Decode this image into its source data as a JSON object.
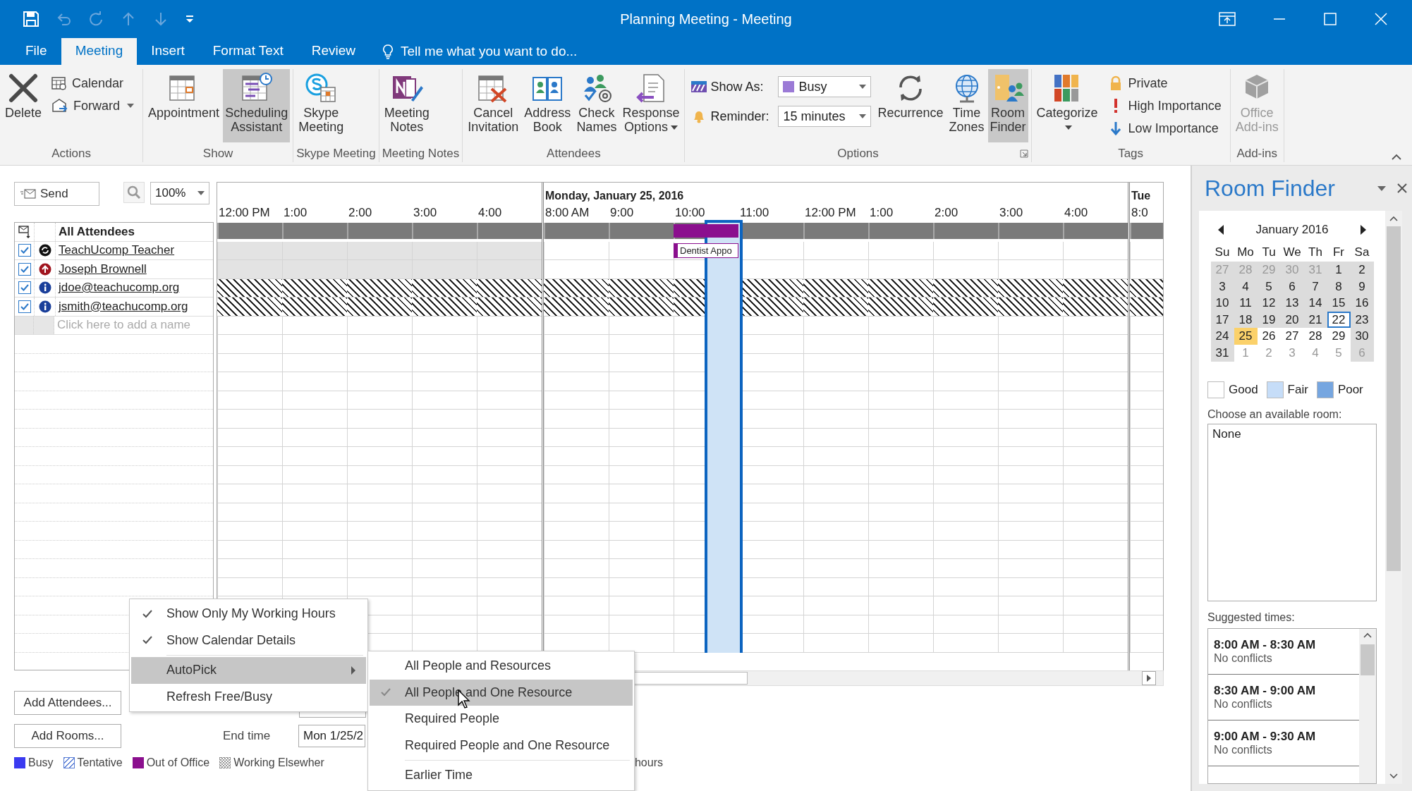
{
  "window": {
    "title": "Planning Meeting - Meeting"
  },
  "quick_access": [
    {
      "kind": "save",
      "disabled": false
    },
    {
      "kind": "undo",
      "disabled": true
    },
    {
      "kind": "redo",
      "disabled": true
    },
    {
      "kind": "previous",
      "disabled": true
    },
    {
      "kind": "next",
      "disabled": true
    },
    {
      "kind": "customize",
      "disabled": false
    }
  ],
  "window_controls": [
    {
      "kind": "ribbon_options"
    },
    {
      "kind": "minimize"
    },
    {
      "kind": "maximize"
    },
    {
      "kind": "close"
    }
  ],
  "tabs": [
    {
      "label": "File",
      "selected": false
    },
    {
      "label": "Meeting",
      "selected": true
    },
    {
      "label": "Insert",
      "selected": false
    },
    {
      "label": "Format Text",
      "selected": false
    },
    {
      "label": "Review",
      "selected": false
    }
  ],
  "tell_me": {
    "placeholder": "Tell me what you want to do..."
  },
  "ribbon_groups": [
    {
      "label": "Actions",
      "buttons": [
        {
          "kind": "delete",
          "label": "Delete"
        }
      ],
      "small_buttons": [
        {
          "kind": "calendar",
          "label": "Calendar"
        },
        {
          "kind": "forward",
          "label": "Forward",
          "dropdown": true
        }
      ]
    },
    {
      "label": "Show",
      "buttons": [
        {
          "kind": "appointment",
          "label": "Appointment",
          "on": false
        },
        {
          "kind": "scheduling_assistant",
          "label": "Scheduling Assistant",
          "on": true
        }
      ]
    },
    {
      "label": "Skype Meeting",
      "buttons": [
        {
          "kind": "skype_meeting",
          "label": "Skype Meeting"
        }
      ]
    },
    {
      "label": "Meeting Notes",
      "buttons": [
        {
          "kind": "meeting_notes",
          "label": "Meeting Notes"
        }
      ]
    },
    {
      "label": "Attendees",
      "buttons": [
        {
          "kind": "cancel_invitation",
          "label": "Cancel Invitation"
        },
        {
          "kind": "address_book",
          "label": "Address Book"
        },
        {
          "kind": "check_names",
          "label": "Check Names"
        },
        {
          "kind": "response_options",
          "label": "Response Options",
          "dropdown": true
        }
      ]
    },
    {
      "label": "Options",
      "launcher": true,
      "fields": [
        {
          "kind": "show_as",
          "label": "Show As:",
          "value": "Busy"
        },
        {
          "kind": "reminder",
          "label": "Reminder:",
          "value": "15 minutes"
        }
      ],
      "buttons": [
        {
          "kind": "recurrence",
          "label": "Recurrence"
        },
        {
          "kind": "time_zones",
          "label": "Time Zones"
        },
        {
          "kind": "room_finder",
          "label": "Room Finder",
          "on": true
        }
      ]
    },
    {
      "label": "Tags",
      "buttons": [
        {
          "kind": "categorize",
          "label": "Categorize",
          "dropdown": true
        }
      ],
      "small_buttons": [
        {
          "kind": "private",
          "label": "Private"
        },
        {
          "kind": "high_importance",
          "label": "High Importance"
        },
        {
          "kind": "low_importance",
          "label": "Low Importance"
        }
      ]
    },
    {
      "label": "Add-ins",
      "buttons": [
        {
          "kind": "office_addins",
          "label": "Office Add-ins",
          "disabled": true
        }
      ]
    }
  ],
  "scheduling": {
    "send_button": "Send",
    "zoom_value": "100%",
    "attendee_header": "All Attendees",
    "attendees": [
      {
        "name": "TeachUcomp Teacher",
        "kind": "organizer",
        "checked": true,
        "days": [
          {
            "kind": "nonworking"
          },
          {
            "kind": "free",
            "slots": [
              {
                "kind": "open"
              },
              {
                "kind": "open"
              },
              {
                "kind": "out_of_office",
                "label": "Dentist Appo"
              },
              {
                "kind": "open"
              },
              {
                "kind": "open"
              },
              {
                "kind": "open"
              },
              {
                "kind": "open"
              },
              {
                "kind": "open"
              },
              {
                "kind": "open"
              }
            ]
          },
          {
            "kind": "free"
          }
        ]
      },
      {
        "name": "Joseph Brownell",
        "kind": "required",
        "checked": true,
        "days": [
          {
            "kind": "nonworking"
          },
          {
            "kind": "free"
          },
          {
            "kind": "free"
          }
        ]
      },
      {
        "name": "jdoe@teachucomp.org",
        "kind": "unknown",
        "checked": true,
        "days": [
          {
            "kind": "no_info"
          },
          {
            "kind": "no_info"
          },
          {
            "kind": "no_info"
          }
        ]
      },
      {
        "name": "jsmith@teachucomp.org",
        "kind": "unknown",
        "checked": true,
        "days": [
          {
            "kind": "no_info"
          },
          {
            "kind": "no_info"
          },
          {
            "kind": "no_info"
          }
        ]
      }
    ],
    "add_name": {
      "placeholder": "Click here to add a name"
    },
    "summary_days": [
      {
        "kind": "summary"
      },
      {
        "kind": "summary",
        "slots": [
          {
            "kind": "open"
          },
          {
            "kind": "open"
          },
          {
            "kind": "out_of_office"
          },
          {
            "kind": "open"
          },
          {
            "kind": "open"
          },
          {
            "kind": "open"
          },
          {
            "kind": "open"
          },
          {
            "kind": "open"
          },
          {
            "kind": "open"
          }
        ]
      },
      {
        "kind": "summary"
      }
    ],
    "days": [
      {
        "hours": [
          {
            "label": "12:00 PM"
          },
          {
            "label": "1:00"
          },
          {
            "label": "2:00"
          },
          {
            "label": "3:00"
          },
          {
            "label": "4:00"
          }
        ]
      },
      {
        "header": "Monday, January 25, 2016",
        "hours": [
          {
            "label": "8:00 AM"
          },
          {
            "label": "9:00"
          },
          {
            "label": "10:00",
            "selection": {
              "kind": "second_half"
            }
          },
          {
            "label": "11:00"
          },
          {
            "label": "12:00 PM"
          },
          {
            "label": "1:00"
          },
          {
            "label": "2:00"
          },
          {
            "label": "3:00"
          },
          {
            "label": "4:00"
          }
        ]
      },
      {
        "header": "Tue",
        "hours": [
          {
            "label": "8:0"
          }
        ]
      }
    ],
    "add_attendees": "Add Attendees...",
    "add_rooms": "Add Rooms...",
    "end_time": {
      "label": "End time",
      "value": "Mon 1/25/2"
    },
    "legend": [
      {
        "kind": "busy",
        "label": "Busy"
      },
      {
        "kind": "tentative",
        "label": "Tentative"
      },
      {
        "kind": "out_of_office",
        "label": "Out of Office"
      },
      {
        "kind": "working_elsewhere",
        "label": "Working Elsewher"
      },
      {
        "kind": "outside_hours",
        "label": "hours"
      }
    ]
  },
  "context_menu": {
    "items": [
      {
        "label": "Show Only My Working Hours",
        "checked": true,
        "selected": false
      },
      {
        "label": "Show Calendar Details",
        "checked": true,
        "selected": false
      },
      {
        "label": "AutoPick",
        "checked": false,
        "selected": true,
        "submenu": true,
        "separator_before": true
      },
      {
        "label": "Refresh Free/Busy",
        "checked": false,
        "selected": false
      }
    ]
  },
  "submenu": {
    "items": [
      {
        "label": "All People and Resources",
        "checked": false,
        "selected": false
      },
      {
        "label": "All People and One Resource",
        "checked": true,
        "selected": true
      },
      {
        "label": "Required People",
        "checked": false,
        "selected": false
      },
      {
        "label": "Required People and One Resource",
        "checked": false,
        "selected": false
      },
      {
        "label": "Earlier Time",
        "checked": false,
        "selected": false,
        "separator_before": true
      }
    ]
  },
  "room_finder": {
    "title": "Room Finder",
    "month": "January 2016",
    "weekdays": [
      "Su",
      "Mo",
      "Tu",
      "We",
      "Th",
      "Fr",
      "Sa"
    ],
    "weeks": [
      [
        {
          "day": "27",
          "other_month": true,
          "shaded": true,
          "today": false,
          "selected": false
        },
        {
          "day": "28",
          "other_month": true,
          "shaded": true,
          "today": false,
          "selected": false
        },
        {
          "day": "29",
          "other_month": true,
          "shaded": true,
          "today": false,
          "selected": false
        },
        {
          "day": "30",
          "other_month": true,
          "shaded": true,
          "today": false,
          "selected": false
        },
        {
          "day": "31",
          "other_month": true,
          "shaded": true,
          "today": false,
          "selected": false
        },
        {
          "day": "1",
          "other_month": false,
          "shaded": true,
          "today": false,
          "selected": false
        },
        {
          "day": "2",
          "other_month": false,
          "shaded": true,
          "today": false,
          "selected": false
        }
      ],
      [
        {
          "day": "3",
          "other_month": false,
          "shaded": true,
          "today": false,
          "selected": false
        },
        {
          "day": "4",
          "other_month": false,
          "shaded": true,
          "today": false,
          "selected": false
        },
        {
          "day": "5",
          "other_month": false,
          "shaded": true,
          "today": false,
          "selected": false
        },
        {
          "day": "6",
          "other_month": false,
          "shaded": true,
          "today": false,
          "selected": false
        },
        {
          "day": "7",
          "other_month": false,
          "shaded": true,
          "today": false,
          "selected": false
        },
        {
          "day": "8",
          "other_month": false,
          "shaded": true,
          "today": false,
          "selected": false
        },
        {
          "day": "9",
          "other_month": false,
          "shaded": true,
          "today": false,
          "selected": false
        }
      ],
      [
        {
          "day": "10",
          "other_month": false,
          "shaded": true,
          "today": false,
          "selected": false
        },
        {
          "day": "11",
          "other_month": false,
          "shaded": true,
          "today": false,
          "selected": false
        },
        {
          "day": "12",
          "other_month": false,
          "shaded": true,
          "today": false,
          "selected": false
        },
        {
          "day": "13",
          "other_month": false,
          "shaded": true,
          "today": false,
          "selected": false
        },
        {
          "day": "14",
          "other_month": false,
          "shaded": true,
          "today": false,
          "selected": false
        },
        {
          "day": "15",
          "other_month": false,
          "shaded": true,
          "today": false,
          "selected": false
        },
        {
          "day": "16",
          "other_month": false,
          "shaded": true,
          "today": false,
          "selected": false
        }
      ],
      [
        {
          "day": "17",
          "other_month": false,
          "shaded": true,
          "today": false,
          "selected": false
        },
        {
          "day": "18",
          "other_month": false,
          "shaded": true,
          "today": false,
          "selected": false
        },
        {
          "day": "19",
          "other_month": false,
          "shaded": true,
          "today": false,
          "selected": false
        },
        {
          "day": "20",
          "other_month": false,
          "shaded": true,
          "today": false,
          "selected": false
        },
        {
          "day": "21",
          "other_month": false,
          "shaded": true,
          "today": false,
          "selected": false
        },
        {
          "day": "22",
          "other_month": false,
          "shaded": false,
          "today": true,
          "selected": false
        },
        {
          "day": "23",
          "other_month": false,
          "shaded": true,
          "today": false,
          "selected": false
        }
      ],
      [
        {
          "day": "24",
          "other_month": false,
          "shaded": true,
          "today": false,
          "selected": false
        },
        {
          "day": "25",
          "other_month": false,
          "shaded": false,
          "today": false,
          "selected": true
        },
        {
          "day": "26",
          "other_month": false,
          "shaded": false,
          "today": false,
          "selected": false
        },
        {
          "day": "27",
          "other_month": false,
          "shaded": false,
          "today": false,
          "selected": false
        },
        {
          "day": "28",
          "other_month": false,
          "shaded": false,
          "today": false,
          "selected": false
        },
        {
          "day": "29",
          "other_month": false,
          "shaded": false,
          "today": false,
          "selected": false
        },
        {
          "day": "30",
          "other_month": false,
          "shaded": true,
          "today": false,
          "selected": false
        }
      ],
      [
        {
          "day": "31",
          "other_month": false,
          "shaded": true,
          "today": false,
          "selected": false
        },
        {
          "day": "1",
          "other_month": true,
          "shaded": false,
          "today": false,
          "selected": false
        },
        {
          "day": "2",
          "other_month": true,
          "shaded": false,
          "today": false,
          "selected": false
        },
        {
          "day": "3",
          "other_month": true,
          "shaded": false,
          "today": false,
          "selected": false
        },
        {
          "day": "4",
          "other_month": true,
          "shaded": false,
          "today": false,
          "selected": false
        },
        {
          "day": "5",
          "other_month": true,
          "shaded": false,
          "today": false,
          "selected": false
        },
        {
          "day": "6",
          "other_month": true,
          "shaded": true,
          "today": false,
          "selected": false
        }
      ]
    ],
    "legend": [
      {
        "label": "Good",
        "color": "#ffffff"
      },
      {
        "label": "Fair",
        "color": "#c6ddf8"
      },
      {
        "label": "Poor",
        "color": "#76a6e0"
      }
    ],
    "rooms_label": "Choose an available room:",
    "rooms": [
      {
        "name": "None",
        "selected": false
      }
    ],
    "suggested_label": "Suggested times:",
    "suggestions": [
      {
        "time": "8:00 AM - 8:30 AM",
        "detail": "No conflicts"
      },
      {
        "time": "8:30 AM - 9:00 AM",
        "detail": "No conflicts"
      },
      {
        "time": "9:00 AM - 9:30 AM",
        "detail": "No conflicts"
      }
    ]
  }
}
